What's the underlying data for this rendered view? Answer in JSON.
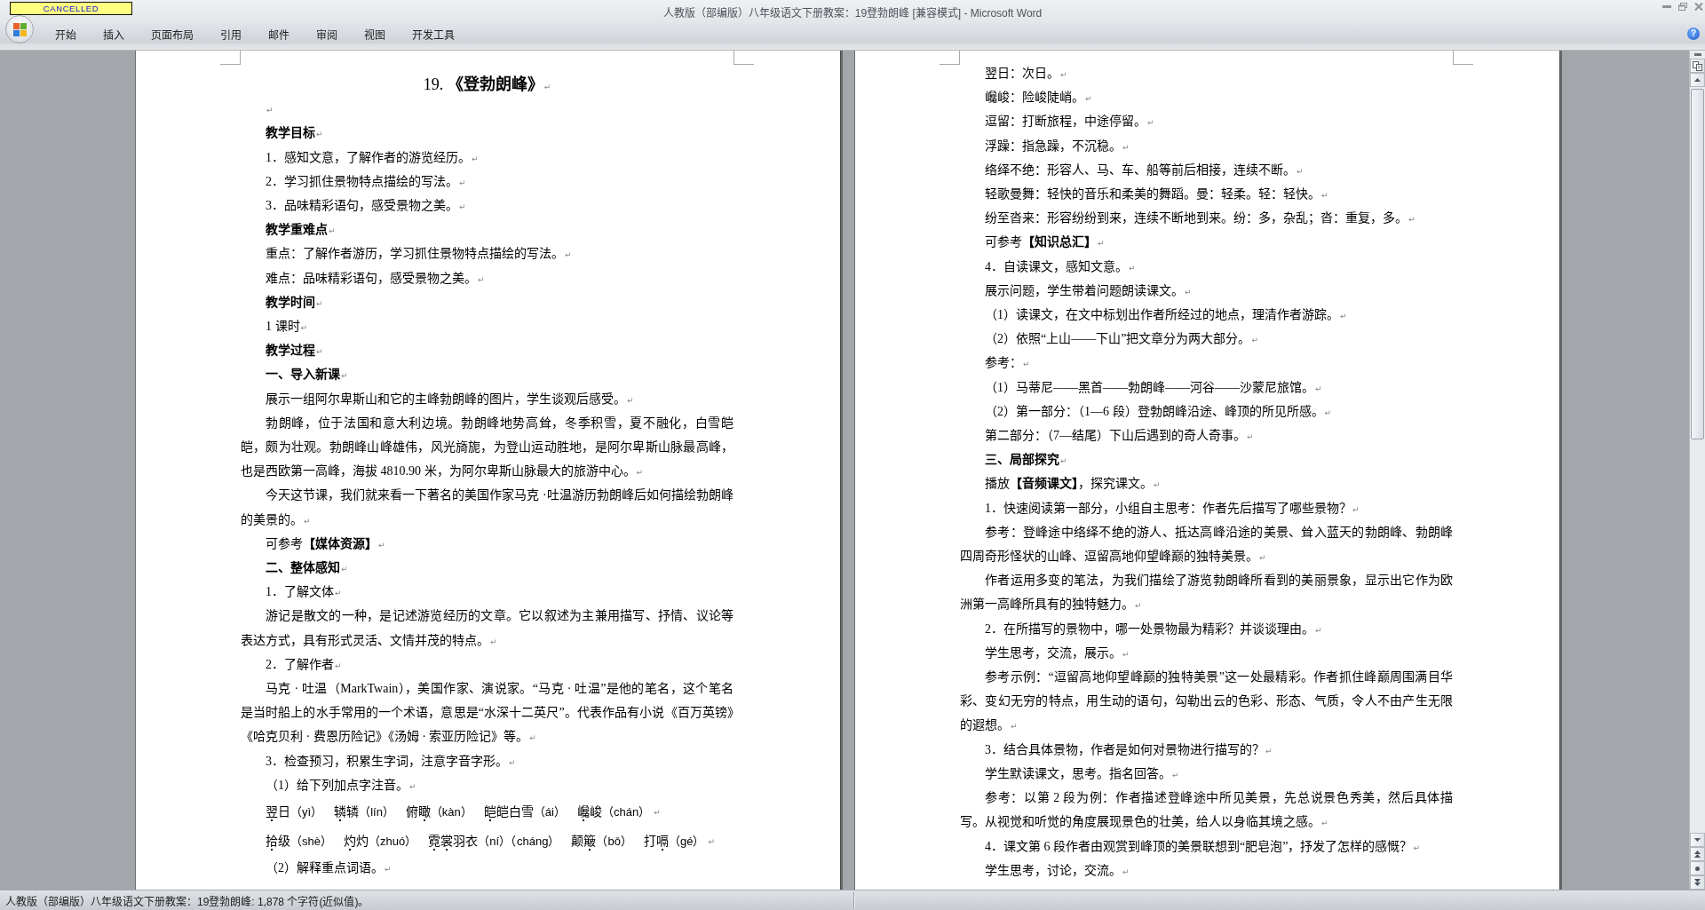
{
  "window": {
    "badge": "CANCELLED",
    "title": "人教版（部编版）八年级语文下册教案：19登勃朗峰 [兼容模式] - Microsoft Word"
  },
  "ribbon": {
    "tabs": [
      {
        "label": "开始",
        "selected": false
      },
      {
        "label": "插入",
        "selected": false
      },
      {
        "label": "页面布局",
        "selected": false
      },
      {
        "label": "引用",
        "selected": false
      },
      {
        "label": "邮件",
        "selected": false
      },
      {
        "label": "审阅",
        "selected": false
      },
      {
        "label": "视图",
        "selected": false
      },
      {
        "label": "开发工具",
        "selected": false
      }
    ],
    "help": "?"
  },
  "pages": [
    {
      "paragraphs": [
        {
          "kind": "title",
          "text": "19. **《登勃朗峰》**",
          "mark": "↵"
        },
        {
          "kind": "blank",
          "mark": "↵"
        },
        {
          "kind": "heading",
          "text": "教学目标",
          "mark": "↵"
        },
        {
          "kind": "text",
          "text": "1．感知文意，了解作者的游览经历。",
          "mark": "↵"
        },
        {
          "kind": "text",
          "text": "2．学习抓住景物特点描绘的写法。",
          "mark": "↵"
        },
        {
          "kind": "text",
          "text": "3．品味精彩语句，感受景物之美。",
          "mark": "↵"
        },
        {
          "kind": "heading",
          "text": "教学重难点",
          "mark": "↵"
        },
        {
          "kind": "text",
          "text": "重点：了解作者游历，学习抓住景物特点描绘的写法。",
          "mark": "↵"
        },
        {
          "kind": "text",
          "text": "难点：品味精彩语句，感受景物之美。",
          "mark": "↵"
        },
        {
          "kind": "heading",
          "text": "教学时间",
          "mark": "↵"
        },
        {
          "kind": "text",
          "text": "1 课时",
          "mark": "↵"
        },
        {
          "kind": "heading",
          "text": "教学过程",
          "mark": "↵"
        },
        {
          "kind": "heading",
          "text": "一、导入新课",
          "mark": "↵"
        },
        {
          "kind": "text",
          "text": "展示一组阿尔卑斯山和它的主峰勃朗峰的图片，学生谈观后感受。",
          "mark": "↵"
        },
        {
          "kind": "text",
          "text": "勃朗峰，位于法国和意大利边境。勃朗峰地势高耸，冬季积雪，夏不融化，白雪皑皑，颇为壮观。勃朗峰山峰雄伟，风光旖旎，为登山运动胜地，是阿尔卑斯山脉最高峰，也是西欧第一高峰，海拔 4810.90 米，为阿尔卑斯山脉最大的旅游中心。",
          "mark": "↵"
        },
        {
          "kind": "text",
          "text": "今天这节课，我们就来看一下著名的美国作家马克 ·吐温游历勃朗峰后如何描绘勃朗峰的美景的。",
          "mark": "↵"
        },
        {
          "kind": "text",
          "text": "可参考**【媒体资源】**",
          "mark": "↵"
        },
        {
          "kind": "heading",
          "text": "二、整体感知",
          "mark": "↵"
        },
        {
          "kind": "text",
          "text": "1．了解文体",
          "mark": "↵"
        },
        {
          "kind": "text",
          "text": "游记是散文的一种，是记述游览经历的文章。它以叙述为主兼用描写、抒情、议论等表达方式，具有形式灵活、文情并茂的特点。",
          "mark": "↵"
        },
        {
          "kind": "text",
          "text": "2．了解作者",
          "mark": "↵"
        },
        {
          "kind": "text",
          "text": "马克 · 吐温（MarkTwain），美国作家、演说家。“马克 · 吐温”是他的笔名，这个笔名是当时船上的水手常用的一个术语，意思是“水深十二英尺”。代表作品有小说《百万英镑》《哈克贝利 · 费恩历险记》《汤姆 · 索亚历险记》等。",
          "mark": "↵"
        },
        {
          "kind": "text",
          "text": "3．检查预习，积累生字词，注意字音字形。",
          "mark": "↵"
        },
        {
          "kind": "text",
          "text": "（1）给下列加点字注音。",
          "mark": "↵"
        },
        {
          "kind": "pinyin_row",
          "mark": "↵",
          "items": [
            {
              "parts": [
                {
                  "text": "翌",
                  "dotted": true
                },
                {
                  "text": "日",
                  "dotted": false
                }
              ],
              "reading": "（yì）"
            },
            {
              "parts": [
                {
                  "text": "辚",
                  "dotted": true
                },
                {
                  "text": "辚",
                  "dotted": false
                }
              ],
              "reading": "（lín）"
            },
            {
              "parts": [
                {
                  "text": "俯",
                  "dotted": false
                },
                {
                  "text": "瞰",
                  "dotted": true
                }
              ],
              "reading": "（kàn）"
            },
            {
              "parts": [
                {
                  "text": "皑",
                  "dotted": true
                },
                {
                  "text": "皑白雪",
                  "dotted": false
                }
              ],
              "reading": "（ái）"
            },
            {
              "parts": [
                {
                  "text": "巉",
                  "dotted": true
                },
                {
                  "text": "峻",
                  "dotted": false
                }
              ],
              "reading": "（chán）"
            }
          ]
        },
        {
          "kind": "pinyin_row",
          "mark": "↵",
          "items": [
            {
              "parts": [
                {
                  "text": "拾",
                  "dotted": true
                },
                {
                  "text": "级",
                  "dotted": false
                }
              ],
              "reading": "（shè）"
            },
            {
              "parts": [
                {
                  "text": "灼",
                  "dotted": true
                },
                {
                  "text": "灼",
                  "dotted": false
                }
              ],
              "reading": "（zhuó）"
            },
            {
              "parts": [
                {
                  "text": "霓",
                  "dotted": true
                },
                {
                  "text": "裳",
                  "dotted": true
                },
                {
                  "text": "羽衣",
                  "dotted": false
                }
              ],
              "reading": "（ní）（cháng）"
            },
            {
              "parts": [
                {
                  "text": "颠",
                  "dotted": false
                },
                {
                  "text": "簸",
                  "dotted": true
                }
              ],
              "reading": "（bǒ）"
            },
            {
              "parts": [
                {
                  "text": "打",
                  "dotted": false
                },
                {
                  "text": "嗝",
                  "dotted": true
                }
              ],
              "reading": "（gé）"
            }
          ]
        },
        {
          "kind": "text",
          "text": "（2）解释重点词语。",
          "mark": "↵"
        }
      ]
    },
    {
      "paragraphs": [
        {
          "kind": "text",
          "text": "翌日：次日。",
          "mark": "↵"
        },
        {
          "kind": "text",
          "text": "巉峻：险峻陡峭。",
          "mark": "↵"
        },
        {
          "kind": "text",
          "text": "逗留：打断旅程，中途停留。",
          "mark": "↵"
        },
        {
          "kind": "text",
          "text": "浮躁：指急躁，不沉稳。",
          "mark": "↵"
        },
        {
          "kind": "text",
          "text": "络绎不绝：形容人、马、车、船等前后相接，连续不断。",
          "mark": "↵"
        },
        {
          "kind": "text",
          "text": "轻歌曼舞：轻快的音乐和柔美的舞蹈。曼：轻柔。轻：轻快。",
          "mark": "↵"
        },
        {
          "kind": "text",
          "text": "纷至沓来：形容纷纷到来，连续不断地到来。纷：多，杂乱；沓：重复，多。",
          "mark": "↵"
        },
        {
          "kind": "text",
          "text": "可参考**【知识总汇】**",
          "mark": "↵"
        },
        {
          "kind": "text",
          "text": "4．自读课文，感知文意。",
          "mark": "↵"
        },
        {
          "kind": "text",
          "text": "展示问题，学生带着问题朗读课文。",
          "mark": "↵"
        },
        {
          "kind": "text",
          "text": "（1）读课文，在文中标划出作者所经过的地点，理清作者游踪。",
          "mark": "↵"
        },
        {
          "kind": "text",
          "text": "（2）依照“上山——下山”把文章分为两大部分。",
          "mark": "↵"
        },
        {
          "kind": "text",
          "text": "参考：",
          "mark": "↵"
        },
        {
          "kind": "text",
          "text": "（1）马蒂尼——黑首——勃朗峰——河谷——沙蒙尼旅馆。",
          "mark": "↵"
        },
        {
          "kind": "text",
          "text": "（2）第一部分：（1—6 段）登勃朗峰沿途、峰顶的所见所感。",
          "mark": "↵"
        },
        {
          "kind": "text",
          "text": "第二部分：（7—结尾）下山后遇到的奇人奇事。",
          "mark": "↵"
        },
        {
          "kind": "heading",
          "text": "三、局部探究",
          "mark": "↵"
        },
        {
          "kind": "text",
          "text": "播放**【音频课文】**，探究课文。",
          "mark": "↵"
        },
        {
          "kind": "text",
          "text": "1．快速阅读第一部分，小组自主思考：作者先后描写了哪些景物？",
          "mark": "↵"
        },
        {
          "kind": "text",
          "text": "参考：登峰途中络绎不绝的游人、抵达高峰沿途的美景、耸入蓝天的勃朗峰、勃朗峰四周奇形怪状的山峰、逗留高地仰望峰巅的独特美景。",
          "mark": "↵"
        },
        {
          "kind": "text",
          "text": "作者运用多变的笔法，为我们描绘了游览勃朗峰所看到的美丽景象，显示出它作为欧洲第一高峰所具有的独特魅力。",
          "mark": "↵"
        },
        {
          "kind": "text",
          "text": "2．在所描写的景物中，哪一处景物最为精彩？并谈谈理由。",
          "mark": "↵"
        },
        {
          "kind": "text",
          "text": "学生思考，交流，展示。",
          "mark": "↵"
        },
        {
          "kind": "text",
          "text": "参考示例：“逗留高地仰望峰巅的独特美景”这一处最精彩。作者抓住峰巅周围满目华彩、变幻无穷的特点，用生动的语句，勾勒出云的色彩、形态、气质，令人不由产生无限的遐想。",
          "mark": "↵"
        },
        {
          "kind": "text",
          "text": "3．结合具体景物，作者是如何对景物进行描写的？",
          "mark": "↵"
        },
        {
          "kind": "text",
          "text": "学生默读课文，思考。指名回答。",
          "mark": "↵"
        },
        {
          "kind": "text",
          "text": "参考：以第 2 段为例：作者描述登峰途中所见美景，先总说景色秀美，然后具体描写。从视觉和听觉的角度展现景色的壮美，给人以身临其境之感。",
          "mark": "↵"
        },
        {
          "kind": "text",
          "text": "4．课文第 6 段作者由观赏到峰顶的美景联想到“肥皂泡”，抒发了怎样的感慨？",
          "mark": "↵"
        },
        {
          "kind": "text",
          "text": "学生思考，讨论，交流。",
          "mark": "↵"
        }
      ]
    }
  ],
  "status_bar": {
    "text": "人教版（部编版）八年级语文下册教案：19登勃朗峰: 1,878 个字符(近似值)。"
  }
}
